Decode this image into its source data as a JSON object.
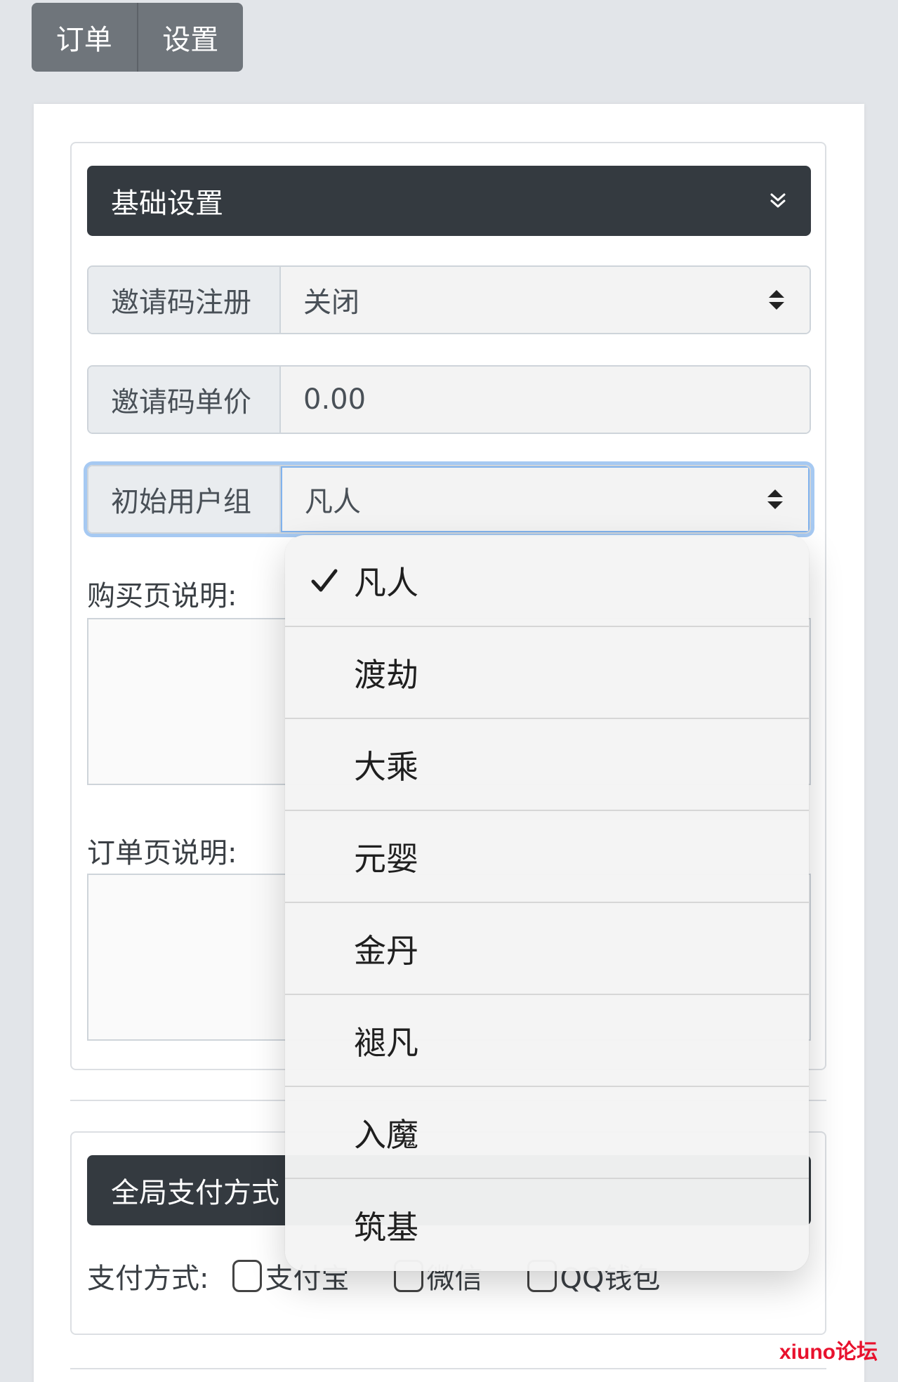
{
  "top_tabs": [
    {
      "label": "订单"
    },
    {
      "label": "设置"
    }
  ],
  "basic_section": {
    "title": "基础设置",
    "invite_register": {
      "label": "邀请码注册",
      "value": "关闭"
    },
    "invite_price": {
      "label": "邀请码单价",
      "value": "0.00"
    },
    "initial_group": {
      "label": "初始用户组",
      "value": "凡人"
    },
    "purchase_desc_label": "购买页说明:",
    "order_desc_label": "订单页说明:"
  },
  "payment_section": {
    "title": "全局支付方式",
    "row_label": "支付方式:",
    "options": [
      {
        "label": "支付宝"
      },
      {
        "label": "微信"
      },
      {
        "label": "QQ钱包"
      }
    ]
  },
  "group_dropdown": {
    "selected": "凡人",
    "options": [
      "凡人",
      "渡劫",
      "大乘",
      "元婴",
      "金丹",
      "褪凡",
      "入魔",
      "筑基"
    ]
  },
  "watermark": "xiuno论坛",
  "colors": {
    "dark_header": "#343a40",
    "tab_bg": "#6f757b",
    "focus_ring": "#80b2ed",
    "watermark": "#e8112d"
  }
}
